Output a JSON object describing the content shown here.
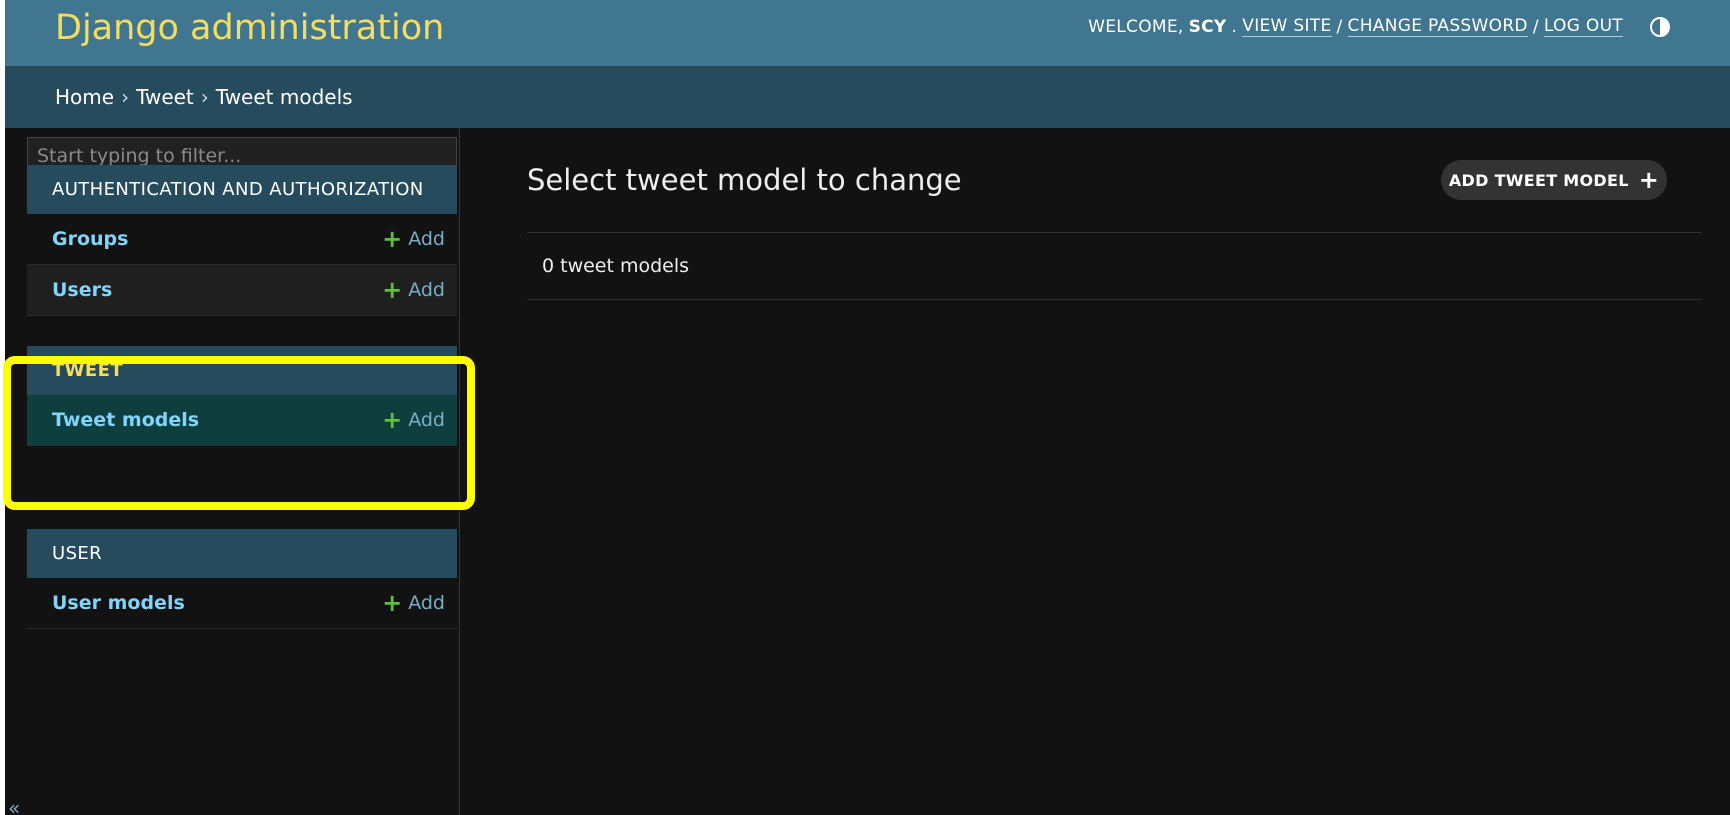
{
  "header": {
    "site_name": "Django administration",
    "welcome": "WELCOME,",
    "username": "SCY",
    "view_site": "VIEW SITE",
    "change_password": "CHANGE PASSWORD",
    "log_out": "LOG OUT",
    "separator": "/",
    "theme_icon": "half-circle-icon"
  },
  "breadcrumbs": {
    "items": [
      "Home",
      "Tweet",
      "Tweet models"
    ],
    "separator": "›"
  },
  "sidebar": {
    "filter_placeholder": "Start typing to filter...",
    "add_label": "Add",
    "collapse_glyph": "«",
    "modules": [
      {
        "caption": "AUTHENTICATION AND AUTHORIZATION",
        "models": [
          "Groups",
          "Users"
        ]
      },
      {
        "caption": "TWEET",
        "models": [
          "Tweet models"
        ]
      },
      {
        "caption": "USER",
        "models": [
          "User models"
        ]
      }
    ]
  },
  "content": {
    "title": "Select tweet model to change",
    "add_button": "ADD TWEET MODEL",
    "result_count": "0 tweet models"
  },
  "colors": {
    "header_bg": "#417690",
    "site_name": "#f5dd5d",
    "breadcrumbs_bg": "#264b5d",
    "body_bg": "#121212",
    "link": "#81d4fa",
    "add_plus": "#5fbf3a",
    "highlight": "#ffff00"
  }
}
